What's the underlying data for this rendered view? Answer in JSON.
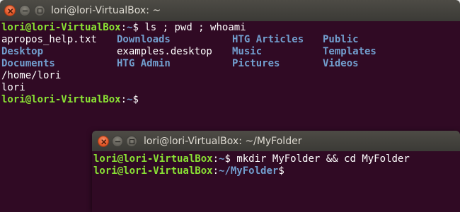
{
  "terminal_main": {
    "title": "lori@lori-VirtualBox: ~",
    "lines": {
      "cmd1": {
        "user": "lori@lori-VirtualBox",
        "sep": ":",
        "path": "~",
        "dollar": "$",
        "command": " ls ; pwd ; whoami"
      },
      "ls_rows": [
        [
          {
            "text": "apropos_help.txt",
            "kind": "file"
          },
          {
            "text": "Downloads",
            "kind": "dir"
          },
          {
            "text": "HTG Articles",
            "kind": "dir"
          },
          {
            "text": "Public",
            "kind": "dir"
          }
        ],
        [
          {
            "text": "Desktop",
            "kind": "dir"
          },
          {
            "text": "examples.desktop",
            "kind": "file"
          },
          {
            "text": "Music",
            "kind": "dir"
          },
          {
            "text": "Templates",
            "kind": "dir"
          }
        ],
        [
          {
            "text": "Documents",
            "kind": "dir"
          },
          {
            "text": "HTG Admin",
            "kind": "dir"
          },
          {
            "text": "Pictures",
            "kind": "dir"
          },
          {
            "text": "Videos",
            "kind": "dir"
          }
        ]
      ],
      "pwd_output": "/home/lori",
      "whoami_output": "lori",
      "prompt2": {
        "user": "lori@lori-VirtualBox",
        "sep": ":",
        "path": "~",
        "dollar": "$"
      }
    }
  },
  "terminal_folder": {
    "title": "lori@lori-VirtualBox: ~/MyFolder",
    "lines": {
      "cmd1": {
        "user": "lori@lori-VirtualBox",
        "sep": ":",
        "path": "~",
        "dollar": "$",
        "command": " mkdir MyFolder && cd MyFolder"
      },
      "prompt2": {
        "user": "lori@lori-VirtualBox",
        "sep": ":",
        "path": "~/MyFolder",
        "dollar": "$"
      }
    }
  },
  "colors": {
    "terminal_bg": "#300a24",
    "prompt_user": "#8ae234",
    "directory": "#729fcf",
    "text": "#ffffff",
    "close_button": "#e4592a",
    "titlebar": "#3c3b37"
  },
  "icons": {
    "close": "close-icon",
    "minimize": "minimize-icon",
    "maximize": "maximize-icon"
  }
}
